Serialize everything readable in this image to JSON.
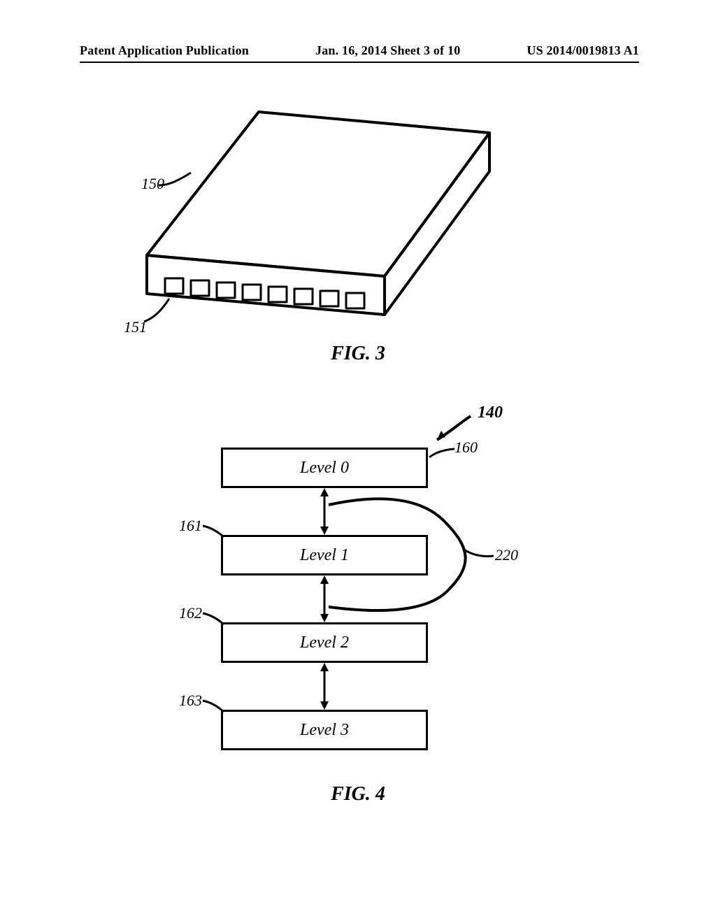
{
  "header": {
    "left": "Patent Application Publication",
    "center": "Jan. 16, 2014  Sheet 3 of 10",
    "right": "US 2014/0019813 A1"
  },
  "fig3": {
    "caption": "FIG. 3",
    "ref_device": "150",
    "ref_port": "151"
  },
  "fig4": {
    "caption": "FIG. 4",
    "ref_top_arrow": "140",
    "levels": [
      {
        "label": "Level 0",
        "ref": "160"
      },
      {
        "label": "Level 1",
        "ref": "161"
      },
      {
        "label": "Level 2",
        "ref": "162"
      },
      {
        "label": "Level 3",
        "ref": "163"
      }
    ],
    "ref_curve": "220"
  }
}
